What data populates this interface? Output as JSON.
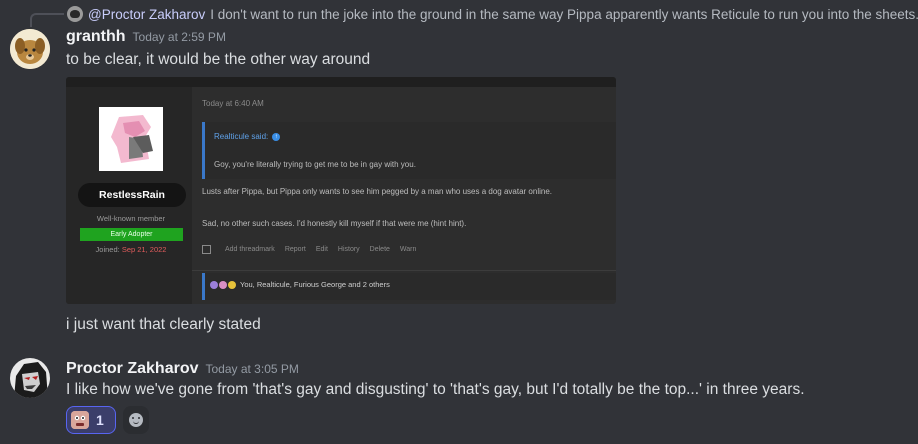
{
  "reply": {
    "author": "@Proctor Zakharov",
    "text": "I don't want to run the joke into the ground in the same way Pippa apparently wants Reticule to run you into the sheets."
  },
  "messages": [
    {
      "author": "granthh",
      "timestamp": "Today at 2:59 PM",
      "lines": [
        "to be clear, it would be the other way around",
        "i just want that clearly stated"
      ]
    },
    {
      "author": "Proctor Zakharov",
      "timestamp": "Today at 3:05 PM",
      "lines": [
        "I like how we've gone from 'that's gay and disgusting' to 'that's gay, but I'd totally be the top...' in three years."
      ]
    }
  ],
  "embed": {
    "username": "RestlessRain",
    "member_title": "Well-known member",
    "badge": "Early Adopter",
    "joined_label": "Joined:",
    "joined_date": "Sep 21, 2022",
    "post_time": "Today at 6:40 AM",
    "quote_author": "Realticule said:",
    "quote_text": "Goy, you're literally trying to get me to be in gay with you.",
    "body_line_1": "Lusts after Pippa, but Pippa only wants to see him pegged by a man who uses a dog avatar online.",
    "body_line_2": "Sad, no other such cases. I'd honestly kill myself if that were me (hint hint).",
    "actions": [
      "Add threadmark",
      "Report",
      "Edit",
      "History",
      "Delete",
      "Warn"
    ],
    "reactions_text": "You, Realticule, Furious George and 2 others"
  },
  "reaction": {
    "count": "1",
    "emoji": "face-emoji"
  },
  "colors": {
    "background": "#313338",
    "reaction_border": "#5865f2",
    "badge_green": "#1fa31f",
    "quote_blue": "#3a78c9"
  }
}
